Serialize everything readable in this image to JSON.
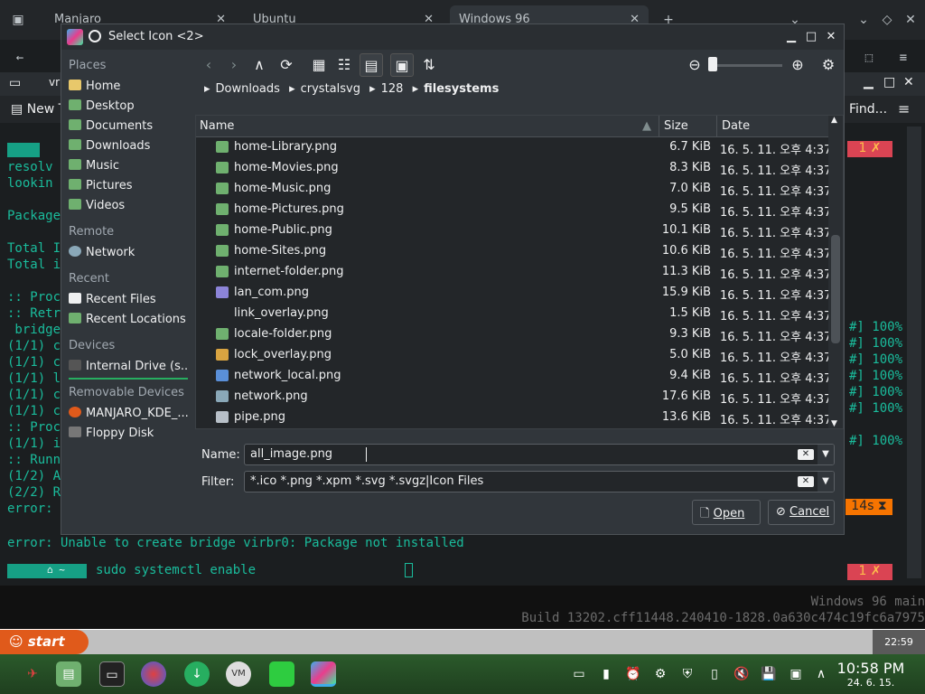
{
  "browser": {
    "tabs": [
      {
        "label": "Manjaro"
      },
      {
        "label": "Ubuntu"
      },
      {
        "label": "Windows 96"
      }
    ]
  },
  "konsole": {
    "new_tab": "New T",
    "find": "Find...",
    "tab_label": "vr"
  },
  "terminal": {
    "lines": [
      "resolv",
      "lookin",
      "",
      "Package",
      "",
      "Total I",
      "Total i",
      "",
      ":: Proc",
      ":: Retr",
      " bridge",
      "(1/1) c",
      "(1/1) c",
      "(1/1) l",
      "(1/1) c",
      "(1/1) c",
      ":: Proc",
      "(1/1) i",
      ":: Runn",
      "(1/2) A",
      "(2/2) R",
      "error: ",
      "error: Unable to create bridge virbr0: Package not installed"
    ],
    "percents": [
      "#] 100%",
      "#] 100%",
      "#] 100%",
      "#] 100%",
      "#] 100%",
      "#] 100%",
      "#] 100%"
    ],
    "prompt_cmd": "sudo systemctl enable",
    "badge_1": "1",
    "badge_2": "1",
    "timer": "14s"
  },
  "dialog": {
    "title": "Select Icon <2>",
    "places_header": "Places",
    "places": [
      "Home",
      "Desktop",
      "Documents",
      "Downloads",
      "Music",
      "Pictures",
      "Videos"
    ],
    "remote_header": "Remote",
    "remote": [
      "Network"
    ],
    "recent_header": "Recent",
    "recent": [
      "Recent Files",
      "Recent Locations"
    ],
    "devices_header": "Devices",
    "devices": [
      "Internal Drive (s..."
    ],
    "removable_header": "Removable Devices",
    "removable": [
      "MANJARO_KDE_...",
      "Floppy Disk"
    ],
    "breadcrumb": [
      "Downloads",
      "crystalsvg",
      "128",
      "filesystems"
    ],
    "columns": {
      "name": "Name",
      "size": "Size",
      "date": "Date"
    },
    "files": [
      {
        "name": "home-Library.png",
        "size": "6.7 KiB",
        "date": "16. 5. 11. 오후 4:37",
        "color": "#6fb06f"
      },
      {
        "name": "home-Movies.png",
        "size": "8.3 KiB",
        "date": "16. 5. 11. 오후 4:37",
        "color": "#6fb06f"
      },
      {
        "name": "home-Music.png",
        "size": "7.0 KiB",
        "date": "16. 5. 11. 오후 4:37",
        "color": "#6fb06f"
      },
      {
        "name": "home-Pictures.png",
        "size": "9.5 KiB",
        "date": "16. 5. 11. 오후 4:37",
        "color": "#6fb06f"
      },
      {
        "name": "home-Public.png",
        "size": "10.1 KiB",
        "date": "16. 5. 11. 오후 4:37",
        "color": "#6fb06f"
      },
      {
        "name": "home-Sites.png",
        "size": "10.6 KiB",
        "date": "16. 5. 11. 오후 4:37",
        "color": "#6fb06f"
      },
      {
        "name": "internet-folder.png",
        "size": "11.3 KiB",
        "date": "16. 5. 11. 오후 4:37",
        "color": "#6fb06f"
      },
      {
        "name": "lan_com.png",
        "size": "15.9 KiB",
        "date": "16. 5. 11. 오후 4:37",
        "color": "#8c84d8"
      },
      {
        "name": "link_overlay.png",
        "size": "1.5 KiB",
        "date": "16. 5. 11. 오후 4:37",
        "color": "transparent"
      },
      {
        "name": "locale-folder.png",
        "size": "9.3 KiB",
        "date": "16. 5. 11. 오후 4:37",
        "color": "#6fb06f"
      },
      {
        "name": "lock_overlay.png",
        "size": "5.0 KiB",
        "date": "16. 5. 11. 오후 4:37",
        "color": "#d9a441"
      },
      {
        "name": "network_local.png",
        "size": "9.4 KiB",
        "date": "16. 5. 11. 오후 4:37",
        "color": "#5a8fd8"
      },
      {
        "name": "network.png",
        "size": "17.6 KiB",
        "date": "16. 5. 11. 오후 4:37",
        "color": "#8aa8b8"
      },
      {
        "name": "pipe.png",
        "size": "13.6 KiB",
        "date": "16. 5. 11. 오후 4:37",
        "color": "#b8c0c8"
      }
    ],
    "name_label": "Name:",
    "name_value": "all_image.png",
    "filter_label": "Filter:",
    "filter_value": "*.ico *.png *.xpm *.svg *.svgz|Icon Files",
    "open": "Open",
    "cancel": "Cancel"
  },
  "win96": {
    "line1": "Windows 96 main",
    "line2": "Build 13202.cff11448.240410-1828.0a630c474c19fc6a7975",
    "start": "start",
    "clock": "22:59"
  },
  "panel": {
    "time": "10:58 PM",
    "date": "24. 6. 15."
  }
}
